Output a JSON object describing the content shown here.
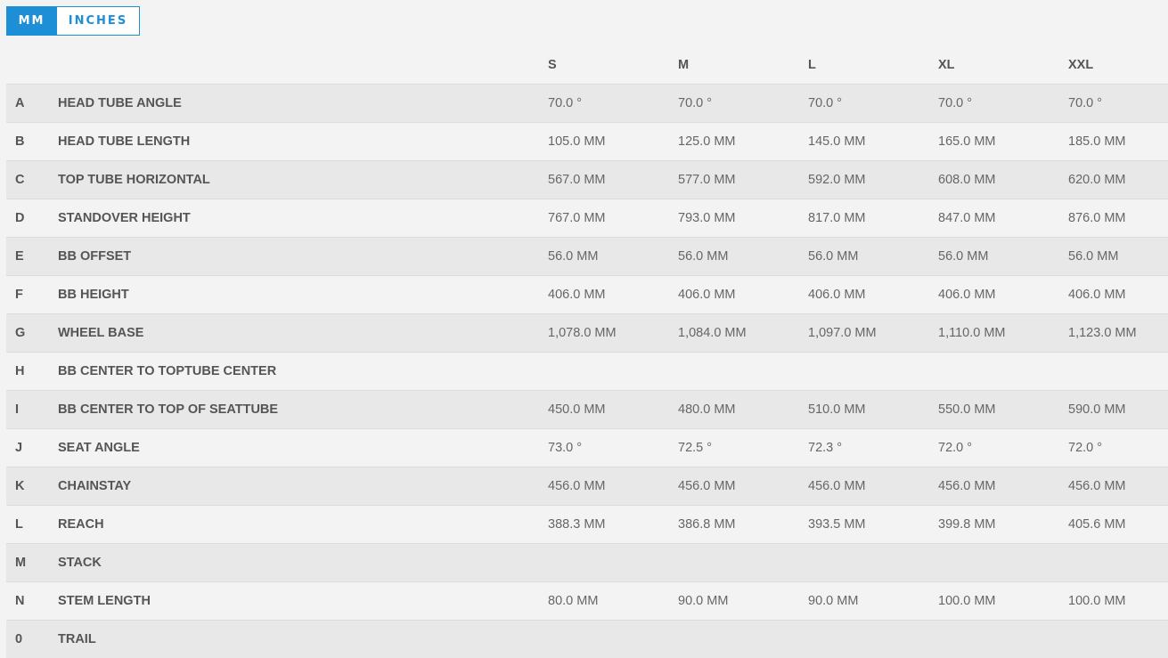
{
  "unit_toggle": {
    "mm_label": "MM",
    "inches_label": "INCHES",
    "active": "MM"
  },
  "table": {
    "size_headers": [
      "S",
      "M",
      "L",
      "XL",
      "XXL"
    ],
    "rows": [
      {
        "letter": "A",
        "label": "HEAD TUBE ANGLE",
        "values": [
          "70.0 °",
          "70.0 °",
          "70.0 °",
          "70.0 °",
          "70.0 °"
        ]
      },
      {
        "letter": "B",
        "label": "HEAD TUBE LENGTH",
        "values": [
          "105.0 MM",
          "125.0 MM",
          "145.0 MM",
          "165.0 MM",
          "185.0 MM"
        ]
      },
      {
        "letter": "C",
        "label": "TOP TUBE HORIZONTAL",
        "values": [
          "567.0 MM",
          "577.0 MM",
          "592.0 MM",
          "608.0 MM",
          "620.0 MM"
        ]
      },
      {
        "letter": "D",
        "label": "STANDOVER HEIGHT",
        "values": [
          "767.0 MM",
          "793.0 MM",
          "817.0 MM",
          "847.0 MM",
          "876.0 MM"
        ]
      },
      {
        "letter": "E",
        "label": "BB OFFSET",
        "values": [
          "56.0 MM",
          "56.0 MM",
          "56.0 MM",
          "56.0 MM",
          "56.0 MM"
        ]
      },
      {
        "letter": "F",
        "label": "BB HEIGHT",
        "values": [
          "406.0 MM",
          "406.0 MM",
          "406.0 MM",
          "406.0 MM",
          "406.0 MM"
        ]
      },
      {
        "letter": "G",
        "label": "WHEEL BASE",
        "values": [
          "1,078.0 MM",
          "1,084.0 MM",
          "1,097.0 MM",
          "1,110.0 MM",
          "1,123.0 MM"
        ]
      },
      {
        "letter": "H",
        "label": "BB CENTER TO TOPTUBE CENTER",
        "values": [
          "",
          "",
          "",
          "",
          ""
        ]
      },
      {
        "letter": "I",
        "label": "BB CENTER TO TOP OF SEATTUBE",
        "values": [
          "450.0 MM",
          "480.0 MM",
          "510.0 MM",
          "550.0 MM",
          "590.0 MM"
        ]
      },
      {
        "letter": "J",
        "label": "SEAT ANGLE",
        "values": [
          "73.0 °",
          "72.5 °",
          "72.3 °",
          "72.0 °",
          "72.0 °"
        ]
      },
      {
        "letter": "K",
        "label": "CHAINSTAY",
        "values": [
          "456.0 MM",
          "456.0 MM",
          "456.0 MM",
          "456.0 MM",
          "456.0 MM"
        ]
      },
      {
        "letter": "L",
        "label": "REACH",
        "values": [
          "388.3 MM",
          "386.8 MM",
          "393.5 MM",
          "399.8 MM",
          "405.6 MM"
        ]
      },
      {
        "letter": "M",
        "label": "STACK",
        "values": [
          "",
          "",
          "",
          "",
          ""
        ]
      },
      {
        "letter": "N",
        "label": "STEM LENGTH",
        "values": [
          "80.0 MM",
          "90.0 MM",
          "90.0 MM",
          "100.0 MM",
          "100.0 MM"
        ]
      },
      {
        "letter": "0",
        "label": "TRAIL",
        "values": [
          "",
          "",
          "",
          "",
          ""
        ]
      }
    ]
  },
  "colors": {
    "accent": "#1d8fd6",
    "row_odd": "#e8e8e8",
    "row_even": "#f3f3f3",
    "background": "#f3f3f3"
  }
}
